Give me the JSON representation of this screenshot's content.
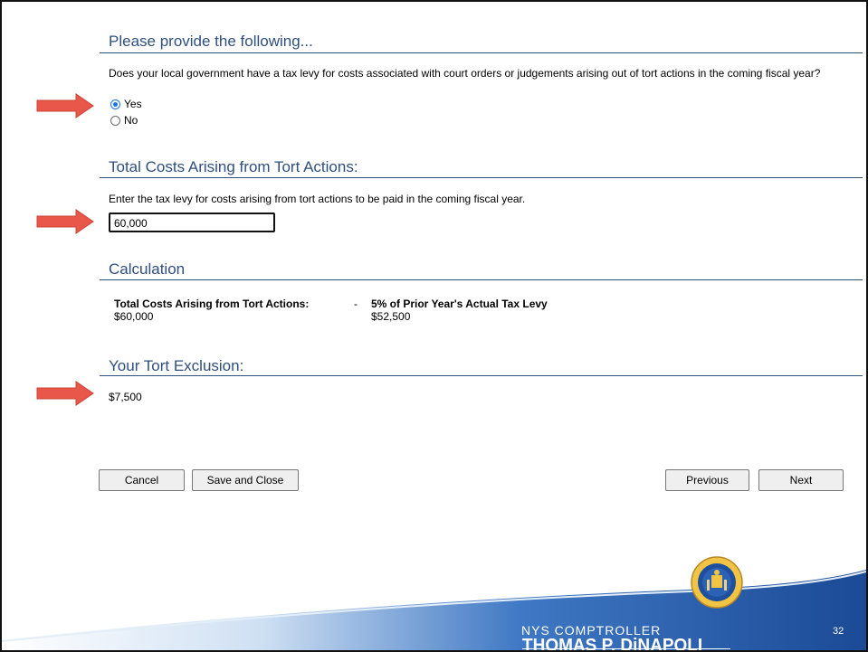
{
  "section1": {
    "title": "Please provide the following...",
    "question": "Does your local government have a tax levy for costs associated with court orders or judgements arising out of tort actions in the coming fiscal year?",
    "options": [
      {
        "label": "Yes",
        "selected": true
      },
      {
        "label": "No",
        "selected": false
      }
    ]
  },
  "section2": {
    "title": "Total Costs Arising from Tort Actions:",
    "instruction": "Enter the tax levy for costs arising from tort actions to be paid in the coming fiscal year.",
    "input_value": "60,000"
  },
  "section3": {
    "title": "Calculation",
    "left_label": "Total Costs Arising from Tort Actions:",
    "operator": "-",
    "right_label": "5% of Prior Year's Actual Tax Levy",
    "left_value": "$60,000",
    "right_value": "$52,500"
  },
  "section4": {
    "title": "Your Tort Exclusion:",
    "value": "$7,500"
  },
  "buttons": {
    "cancel": "Cancel",
    "save_close": "Save and Close",
    "previous": "Previous",
    "next": "Next"
  },
  "footer": {
    "line1": "NYS COMPTROLLER",
    "line2": "THOMAS P. DiNAPOLI",
    "page_number": "32",
    "seal_icon": "nys-seal-icon"
  },
  "colors": {
    "heading": "#2f4f7f",
    "arrow": "#e8574a",
    "footer_blue": "#1e4f9c",
    "radio_checked": "#1a73e8"
  }
}
